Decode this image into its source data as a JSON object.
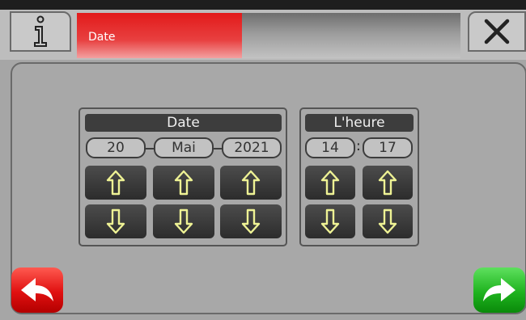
{
  "header": {
    "title": "Date",
    "progress": 0.43
  },
  "icons": {
    "info": "info-icon",
    "close": "close-icon",
    "back": "back-arrow-icon",
    "forward": "forward-arrow-icon",
    "up": "up-arrow-icon",
    "down": "down-arrow-icon"
  },
  "date_group": {
    "label": "Date",
    "day": "20",
    "month": "Mai",
    "year": "2021"
  },
  "time_group": {
    "label": "L'heure",
    "hour": "14",
    "minute": "17",
    "separator": ":"
  },
  "colors": {
    "accent_red": "#e21a1a",
    "next_green": "#1fb31f",
    "arrow_yellow": "#eef294"
  }
}
